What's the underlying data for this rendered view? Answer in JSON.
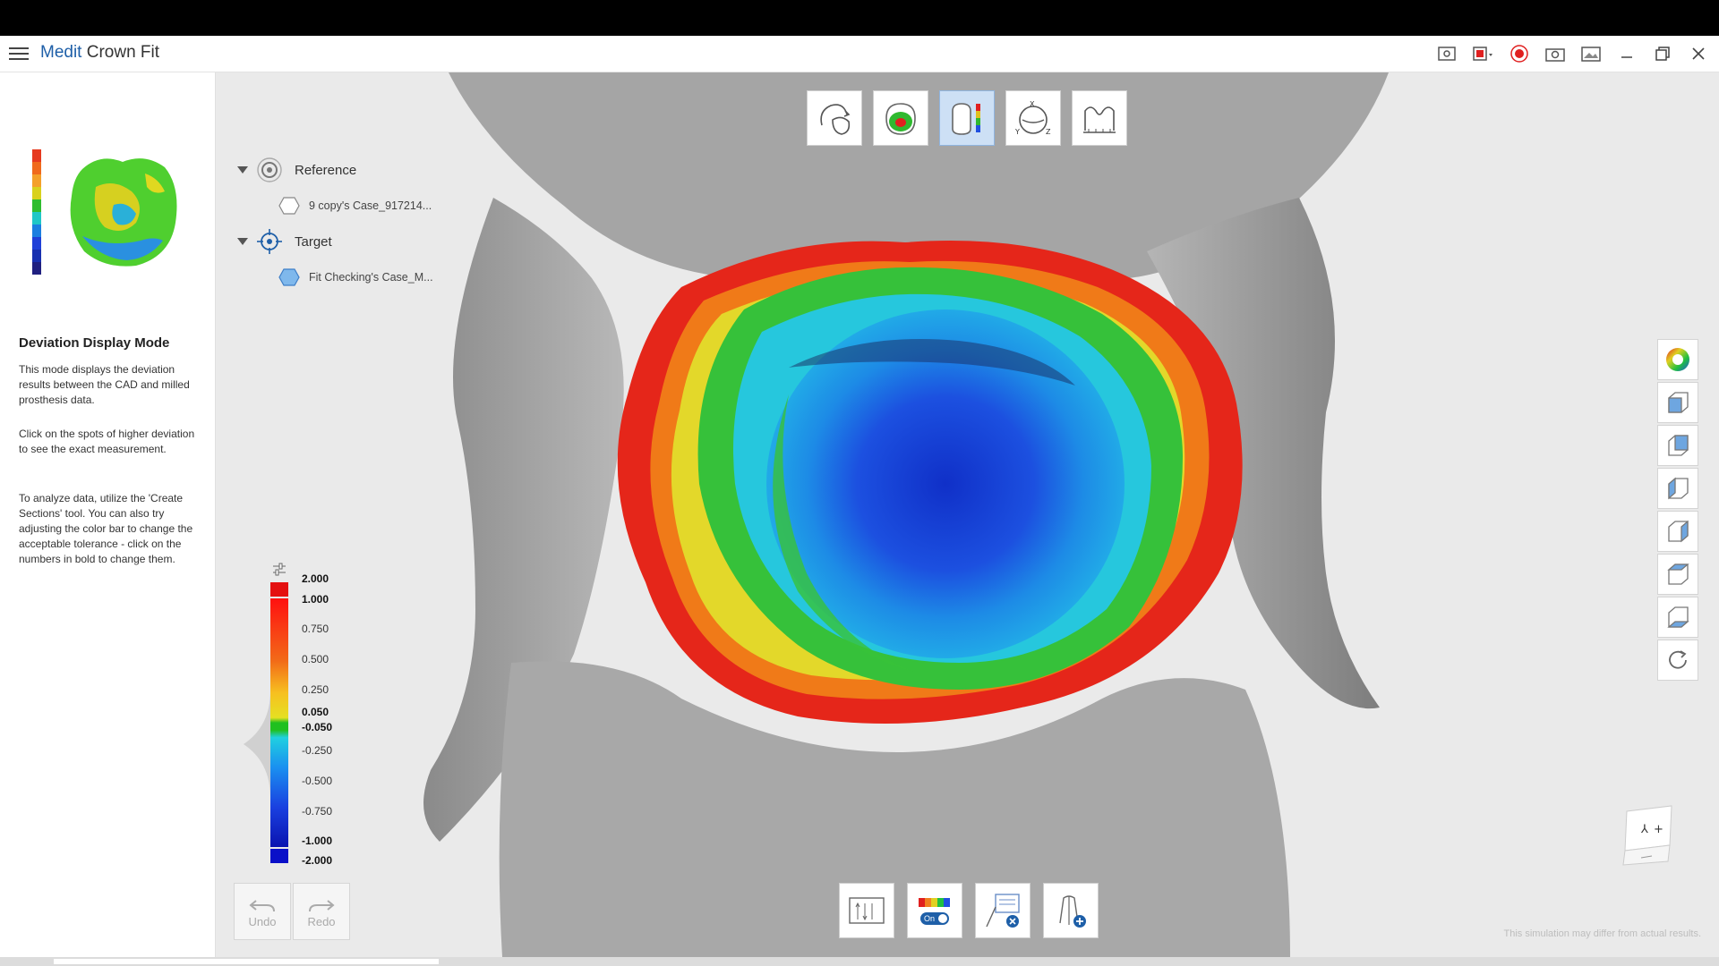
{
  "app": {
    "title_brand": "Medit",
    "title_product": " Crown Fit"
  },
  "colors": {
    "accent": "#1e5fa8",
    "active_tool": "#cde0f5",
    "record": "#e02020"
  },
  "titlebar_icons": [
    "screen-capture-icon",
    "video-record-icon",
    "record-icon",
    "camera-icon",
    "image-icon",
    "minimize-icon",
    "maximize-icon",
    "close-icon"
  ],
  "tree": {
    "reference": {
      "label": "Reference",
      "child": "9 copy's Case_917214..."
    },
    "target": {
      "label": "Target",
      "child": "Fit Checking's Case_M..."
    }
  },
  "mode": {
    "title": "Deviation Display Mode",
    "p1": "This mode displays the deviation results between the CAD and milled prosthesis data.",
    "p2": "Click on the spots of higher deviation to see the exact measurement.",
    "p3": "To analyze data, utilize the 'Create Sections' tool. You can also try adjusting the color bar to change the acceptable tolerance - click on the numbers in bold to change them."
  },
  "top_tools": [
    {
      "name": "align-tool",
      "active": false
    },
    {
      "name": "occlusion-tool",
      "active": false
    },
    {
      "name": "deviation-display-tool",
      "active": true
    },
    {
      "name": "xyz-axis-tool",
      "active": false
    },
    {
      "name": "measure-tool",
      "active": false
    }
  ],
  "bottom_tools": [
    "compare-sections-tool",
    "color-map-toggle-tool",
    "clear-notes-tool",
    "add-section-tool"
  ],
  "color_toggle_label": "On",
  "right_tools": [
    "color-wheel-icon",
    "view-front-icon",
    "view-back-icon",
    "view-left-icon",
    "view-right-icon",
    "view-top-icon",
    "view-bottom-icon",
    "reset-view-icon"
  ],
  "legend": {
    "values": [
      {
        "label": "2.000",
        "bold": true
      },
      {
        "label": "1.000",
        "bold": true
      },
      {
        "label": "0.750",
        "bold": false
      },
      {
        "label": "0.500",
        "bold": false
      },
      {
        "label": "0.250",
        "bold": false
      },
      {
        "label": "0.050",
        "bold": true
      },
      {
        "label": "-0.050",
        "bold": true
      },
      {
        "label": "-0.250",
        "bold": false
      },
      {
        "label": "-0.500",
        "bold": false
      },
      {
        "label": "-0.750",
        "bold": false
      },
      {
        "label": "-1.000",
        "bold": true
      },
      {
        "label": "-2.000",
        "bold": true
      }
    ]
  },
  "undo_label": "Undo",
  "redo_label": "Redo",
  "disclaimer": "This simulation may differ from actual results."
}
